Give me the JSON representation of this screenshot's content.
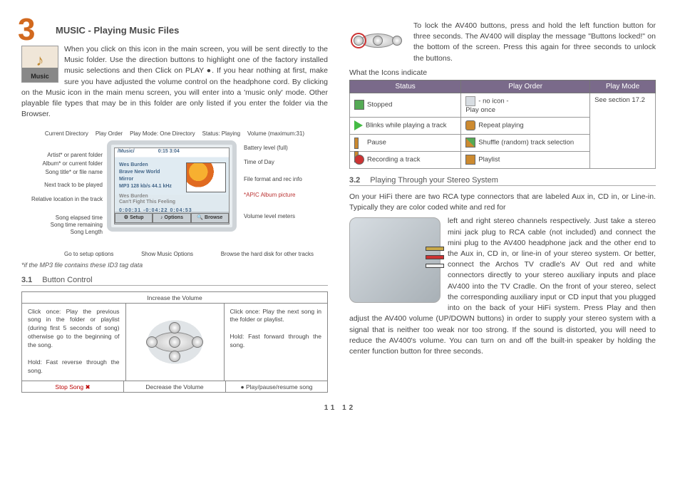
{
  "chapter": {
    "number": "3",
    "title": "MUSIC - Playing Music Files"
  },
  "intro_icon_label": "Music",
  "intro_text": "When you click on this icon in the main screen, you will be sent directly to the Music folder. Use the direction buttons to highlight one of the factory installed music selections and then Click on PLAY ●. If you hear nothing at first, make sure you have adjusted the volume control on the headphone cord. By clicking on the Music icon in the main menu screen, you will enter into a 'music only' mode.  Other playable file types that may be in this folder are only listed if you enter the folder via the Browser.",
  "diagram": {
    "top": [
      "Current Directory",
      "Play Order",
      "Play Mode: One Directory",
      "Status: Playing",
      "Volume (maximum:31)"
    ],
    "left": [
      "Artist* or parent folder",
      "Album* or current folder",
      "Song title* or file name",
      "Next track to be played",
      "Relative location in the track",
      "Song elapsed time",
      "Song time remaining",
      "Song Length"
    ],
    "right": [
      "Battery level (full)",
      "Time of Day",
      "File format and rec info",
      "*APIC Album picture",
      "Volume level meters"
    ],
    "bottom": [
      "Go to setup options",
      "Show Music Options",
      "Browse the hard disk for other tracks"
    ],
    "screen": {
      "path": "/Music/",
      "artist": "Wes Burden",
      "album": "Brave New World",
      "title": "Mirror",
      "codec": "MP3 128 kb/s 44.1 kHz",
      "next1": "Wes Burden",
      "next2": "Can't Fight This Feeling",
      "times": "0:00:31    -0:04:22    0:04:53",
      "btn1": "Setup",
      "btn2": "Options",
      "btn3": "Browse",
      "topright": "0:15    3:04"
    }
  },
  "footnote": "*if the MP3 file contains these ID3 tag data",
  "sec31": {
    "num": "3.1",
    "title": "Button Control"
  },
  "btntable": {
    "top": "Increase the Volume",
    "left": "Click once: Play the previous song in the folder or playlist (during first 5 seconds of song) otherwise go to the beginning of the song.\n\nHold: Fast reverse through the song.",
    "right": "Click once: Play the next song in the folder or playlist.\n\nHold: Fast forward through the song.",
    "bl": "Stop Song ✖",
    "bm": "Decrease the Volume",
    "br": "● Play/pause/resume song"
  },
  "lock_text": "To lock the AV400 buttons, press and hold the left function button for three seconds. The AV400 will display the message \"Buttons locked!\" on the bottom of the screen. Press this again for three seconds to unlock the buttons.",
  "icons_caption": "What the Icons indicate",
  "icons_table": {
    "heads": [
      "Status",
      "Play Order",
      "Play Mode"
    ],
    "r1": [
      "Stopped",
      "- no icon -\nPlay once",
      "See section 17.2"
    ],
    "r2": [
      "Blinks while playing a track",
      "Repeat playing",
      ""
    ],
    "r3": [
      "Pause",
      "Shuffle (random) track selection",
      ""
    ],
    "r4": [
      "Recording a track",
      "Playlist",
      ""
    ]
  },
  "sec32": {
    "num": "3.2",
    "title": "Playing Through your Stereo System"
  },
  "stereo_p1": "On your HiFi there are two RCA type connectors that are labeled Aux in, CD in, or Line-in. Typically they are color coded white and red for",
  "stereo_p2": "left and right stereo channels respectively. Just take a stereo mini jack plug to RCA cable (not included) and connect the mini plug to the AV400 headphone jack and the other end to the Aux in, CD in, or line-in of your stereo system. Or better, connect the Archos TV cradle's AV Out red and white connectors directly to your stereo auxiliary inputs and place AV400 into the TV Cradle.",
  "stereo_p3": "On the front of your stereo, select the corresponding auxiliary input or CD input that you plugged into on the back of your HiFi system. Press Play and then adjust the AV400 volume (UP/DOWN buttons) in order to supply your stereo system with a signal that is neither too weak nor too strong. If the sound is distorted, you will need to reduce the AV400's volume. You can turn on and off the built-in speaker by holding the center function button for three seconds.",
  "pagenums": "11    12"
}
